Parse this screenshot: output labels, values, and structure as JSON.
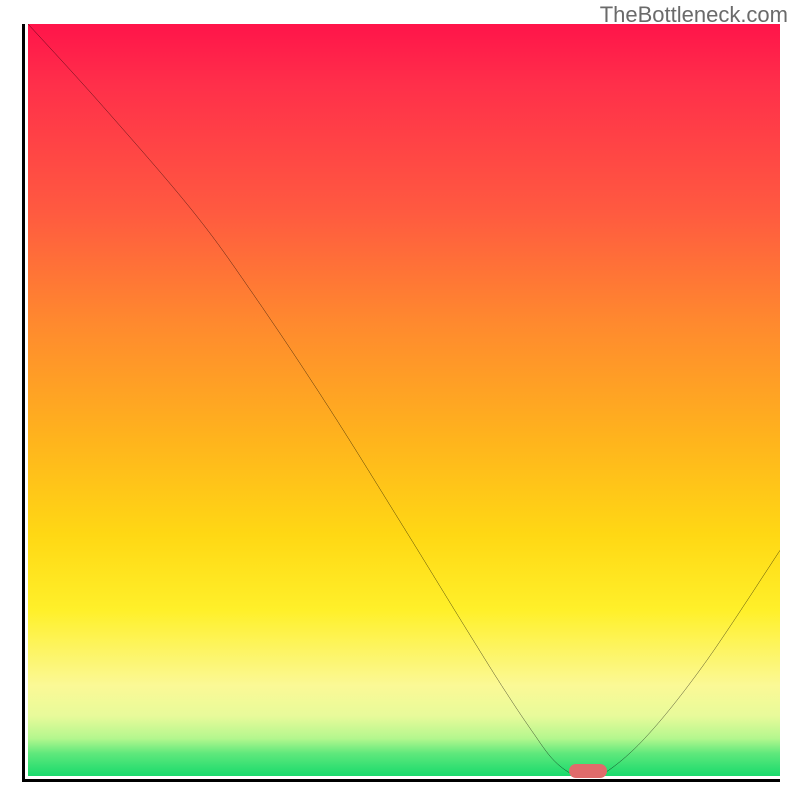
{
  "watermark": "TheBottleneck.com",
  "chart_data": {
    "type": "line",
    "title": "",
    "xlabel": "",
    "ylabel": "",
    "xlim": [
      0,
      100
    ],
    "ylim": [
      0,
      100
    ],
    "grid": false,
    "legend": false,
    "series": [
      {
        "name": "curve",
        "color": "#000000",
        "x": [
          0,
          10,
          22,
          30,
          40,
          50,
          58,
          63,
          67,
          70,
          73,
          76,
          82,
          90,
          100
        ],
        "y": [
          100,
          89,
          75,
          64,
          49,
          33,
          20,
          12,
          6,
          2,
          0,
          0,
          5,
          15,
          30
        ]
      }
    ],
    "marker": {
      "name": "optimal-point",
      "shape": "pill",
      "color": "#e06b6b",
      "x_range": [
        72,
        77
      ],
      "y": 0
    },
    "background_gradient": {
      "orientation": "vertical",
      "stops": [
        {
          "pos": 0.0,
          "color": "#ff144a"
        },
        {
          "pos": 0.25,
          "color": "#ff5a40"
        },
        {
          "pos": 0.55,
          "color": "#ffb31d"
        },
        {
          "pos": 0.78,
          "color": "#fff02a"
        },
        {
          "pos": 0.92,
          "color": "#e8fa9a"
        },
        {
          "pos": 1.0,
          "color": "#18da6c"
        }
      ]
    }
  }
}
